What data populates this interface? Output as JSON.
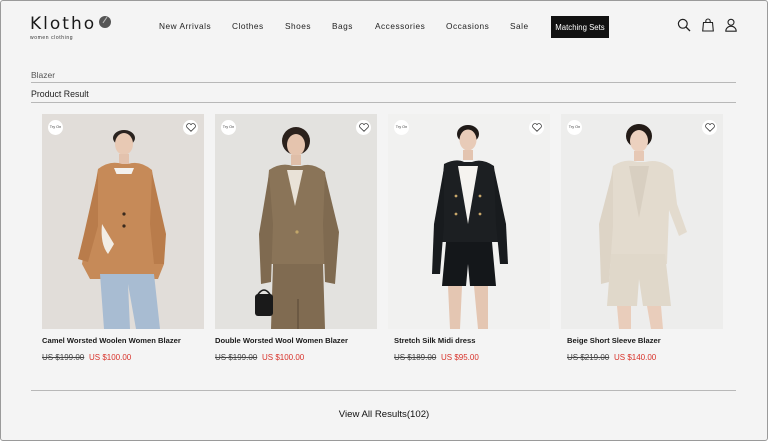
{
  "brand": {
    "name": "Klotho",
    "tagline": "women clothing"
  },
  "nav": {
    "items": [
      {
        "label": "New Arrivals"
      },
      {
        "label": "Clothes"
      },
      {
        "label": "Shoes"
      },
      {
        "label": "Bags"
      },
      {
        "label": "Accessories"
      },
      {
        "label": "Occasions"
      },
      {
        "label": "Sale"
      }
    ],
    "active_label": "Matching Sets"
  },
  "header_icons": [
    "search-icon",
    "shopping-bag-icon",
    "user-icon"
  ],
  "search": {
    "query": "Blazer"
  },
  "results": {
    "title": "Product Result"
  },
  "products": [
    {
      "name": "Camel Worsted Woolen Women Blazer",
      "old_price": "US $199.00",
      "new_price": "US $100.00",
      "try_on": "Try On"
    },
    {
      "name": "Double Worsted Wool Women Blazer",
      "old_price": "US $199.00",
      "new_price": "US $100.00",
      "try_on": "Try On"
    },
    {
      "name": "Stretch Silk Midi dress",
      "old_price": "US $189.00",
      "new_price": "US $95.00",
      "try_on": "Try On"
    },
    {
      "name": "Beige Short Sleeve Blazer",
      "old_price": "US $219.00",
      "new_price": "US $140.00",
      "try_on": "Try On"
    }
  ],
  "view_all": {
    "label": "View All Results(102)"
  },
  "colors": {
    "accent_sale": "#d8322a",
    "active_nav_bg": "#111111",
    "page_bg": "#f4f4f4"
  }
}
